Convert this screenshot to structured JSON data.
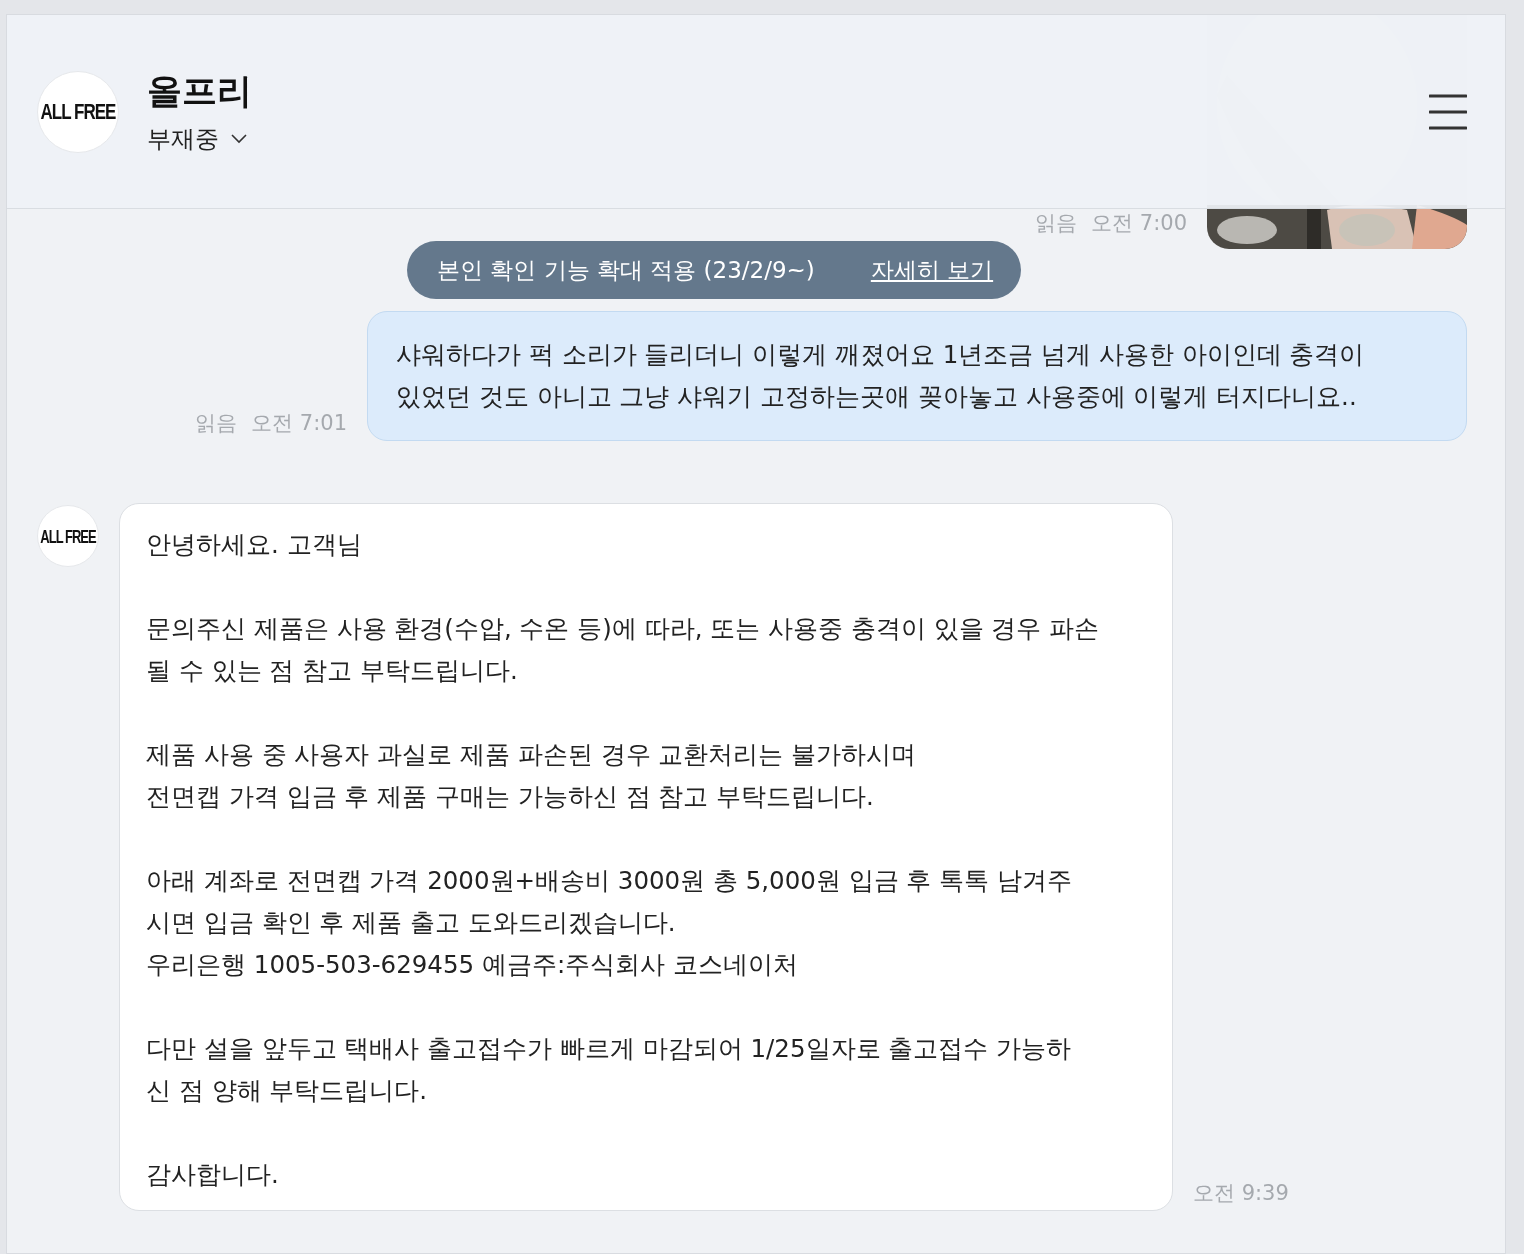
{
  "header": {
    "avatar_text": "ALL FREE",
    "name": "올프리",
    "status": "부재중"
  },
  "notice": {
    "text": "본인 확인 기능 확대 적용 (23/2/9~)",
    "link": "자세히 보기"
  },
  "messages": [
    {
      "outgoing": true,
      "read": "읽음",
      "time": "오전 7:00"
    },
    {
      "kind": "text",
      "outgoing": true,
      "read": "읽음",
      "time": "오전 7:01",
      "text": "샤워하다가 퍽 소리가 들리더니 이렇게 깨졌어요 1년조금 넘게 사용한 아이인데 충격이 있었던 것도 아니고 그냥 샤워기 고정하는곳애 꽂아놓고 사용중에 이렇게 터지다니요.."
    },
    {
      "kind": "text",
      "outgoing": false,
      "avatar_text": "ALL FREE",
      "time": "오전 9:39",
      "text": "안녕하세요. 고객님\n\n문의주신 제품은 사용 환경(수압, 수온 등)에 따라, 또는 사용중 충격이 있을 경우 파손\n될 수 있는 점 참고 부탁드립니다.\n\n제품 사용 중 사용자 과실로 제품 파손된 경우 교환처리는 불가하시며\n전면캡 가격 입금 후 제품 구매는 가능하신 점 참고 부탁드립니다.\n\n아래 계좌로 전면캡 가격 2000원+배송비 3000원 총 5,000원 입금 후 톡톡 남겨주\n시면 입금 확인 후 제품 출고 도와드리겠습니다.\n우리은행 1005-503-629455 예금주:주식회사 코스네이처\n\n다만 설을 앞두고 택배사 출고접수가 빠르게 마감되어 1/25일자로 출고접수 가능하\n신 점 양해 부탁드립니다.\n\n감사합니다."
    }
  ]
}
